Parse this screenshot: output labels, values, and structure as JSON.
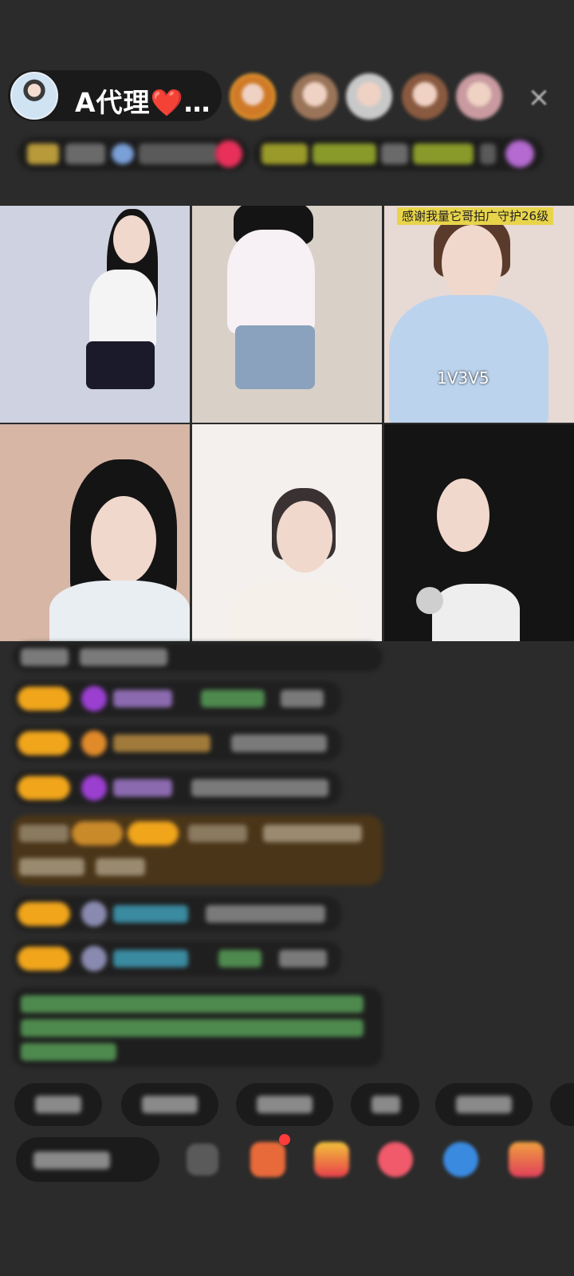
{
  "header": {
    "host_name": "A代理❤️…",
    "host_avatar_icon": "host-avatar-icon",
    "viewer_avatars": [
      {
        "name": "top-viewer-1",
        "color": "#d07a28"
      },
      {
        "name": "top-viewer-2",
        "color": "#9a7458"
      },
      {
        "name": "top-viewer-3",
        "color": "#c9c9c9"
      },
      {
        "name": "top-viewer-4",
        "color": "#8a5a40"
      },
      {
        "name": "top-viewer-5",
        "color": "#c99aa0"
      }
    ],
    "close_icon": "×"
  },
  "grid": {
    "tiles": [
      {
        "bg": "#cfd2e0",
        "body": "#f4f4f4",
        "skirt": "#1a1a2a"
      },
      {
        "bg": "#d9d0c8",
        "body": "#f7f0f4",
        "skirt": "#8aa2bd"
      },
      {
        "bg": "#e7d9d4",
        "body": "#bcd3ee",
        "skirt": "#bcd3ee",
        "banner": "感谢我量它哥拍广守护26级",
        "label": "1V3V5"
      },
      {
        "bg": "#d7b6a6",
        "body": "#e9eef2",
        "skirt": "#e9eef2"
      },
      {
        "bg": "#f3f0ee",
        "body": "#f5f1ea",
        "skirt": "#f5f1ea"
      },
      {
        "bg": "#141414",
        "body": "#eeeeee",
        "skirt": "#eeeeee"
      }
    ]
  },
  "colors": {
    "accent_orange": "#f0a51b",
    "purple_level": "#9b3fd1",
    "green_text": "#4e8a4e",
    "gold_bubble": "#4a3518"
  }
}
